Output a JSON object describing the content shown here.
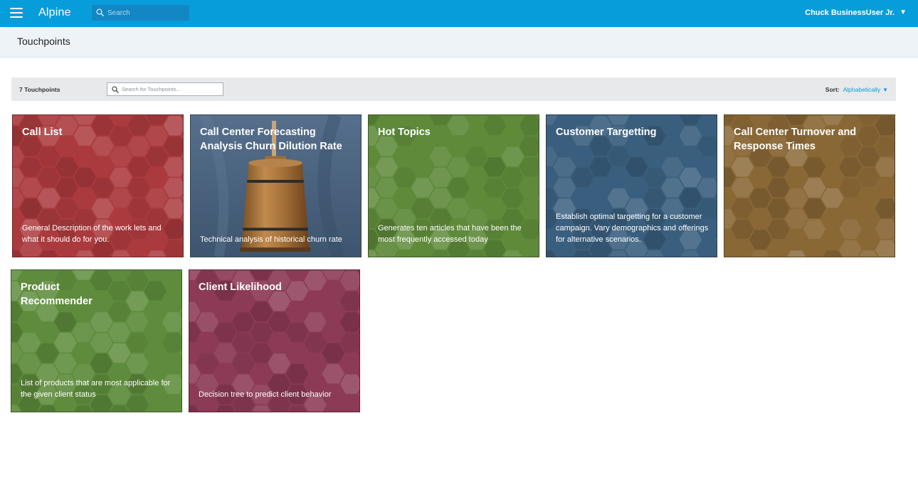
{
  "app": {
    "name": "Alpine"
  },
  "topbar": {
    "search_placeholder": "Search",
    "user_name": "Chuck BusinessUser Jr.",
    "user_caret": "▼"
  },
  "page": {
    "title": "Touchpoints"
  },
  "toolbar": {
    "count_label": "7 Touchpoints",
    "search_placeholder": "Search for Touchpoints...",
    "sort_label": "Sort:",
    "sort_value": "Alphabetically",
    "sort_caret": "▼"
  },
  "icons": {
    "menu": "hamburger-menu-icon",
    "search": "magnifier-search-icon",
    "caret": "triangle-down-icon"
  },
  "colors": {
    "topbar": "#079ddb",
    "accent": "#079ddb"
  },
  "cards": [
    {
      "title": "Call List",
      "description": "General Description of the work lets and what it should do for you.",
      "color": "#ab3a3e",
      "style": "hex"
    },
    {
      "title": "Call Center Forecasting Analysis Churn Dilution Rate",
      "description": "Technical analysis of historical churn rate",
      "color": "#4d6a8a",
      "style": "photo"
    },
    {
      "title": "Hot Topics",
      "description": "Generates ten articles that have been the most frequently accessed today",
      "color": "#5e8a3a",
      "style": "hex"
    },
    {
      "title": "Customer Targetting",
      "description": "Establish optimal targetting for a customer campaign. Vary demographics and offerings for alternative scenarios.",
      "color": "#3a5f7e",
      "style": "hex"
    },
    {
      "title": "Call Center Turnover and Response Times",
      "description": "",
      "color": "#8a6836",
      "style": "hex"
    },
    {
      "title": "Product Recommender",
      "description": "List of products that are most applicable for the given client status",
      "color": "#5e8c3c",
      "style": "hex"
    },
    {
      "title": "Client Likelihood",
      "description": "Decision tree to predict client behavior",
      "color": "#8c3a55",
      "style": "hex"
    }
  ]
}
